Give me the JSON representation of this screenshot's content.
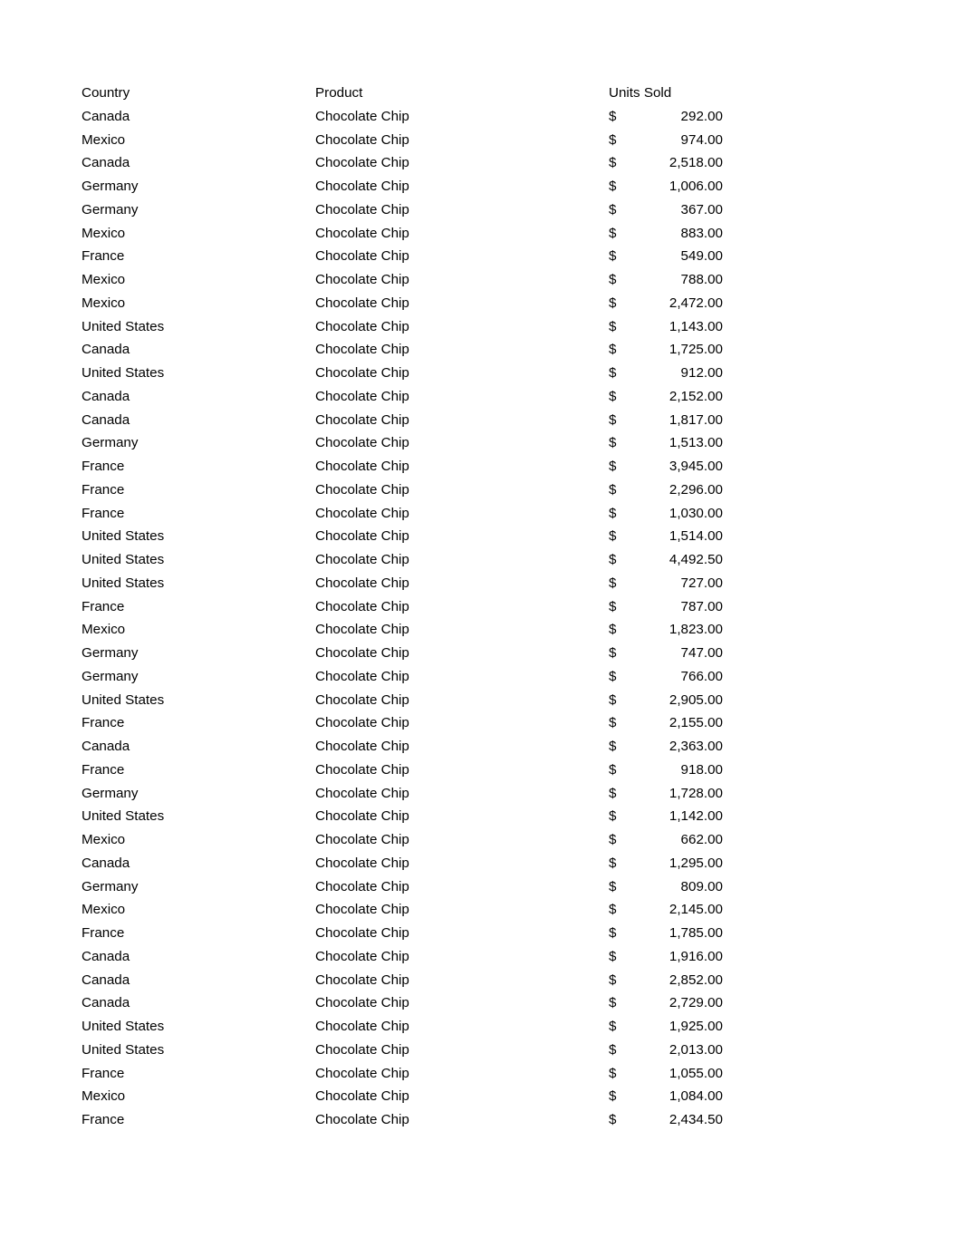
{
  "document": {
    "kind": "spreadsheet-table",
    "page_background": "#ffffff",
    "text_color": "#000000"
  },
  "table": {
    "headers": {
      "country": "Country",
      "product": "Product",
      "units_sold": "Units Sold"
    },
    "currency_symbol": "$",
    "rows": [
      {
        "country": "Canada",
        "product": "Chocolate Chip",
        "amount": "292.00"
      },
      {
        "country": "Mexico",
        "product": "Chocolate Chip",
        "amount": "974.00"
      },
      {
        "country": "Canada",
        "product": "Chocolate Chip",
        "amount": "2,518.00"
      },
      {
        "country": "Germany",
        "product": "Chocolate Chip",
        "amount": "1,006.00"
      },
      {
        "country": "Germany",
        "product": "Chocolate Chip",
        "amount": "367.00"
      },
      {
        "country": "Mexico",
        "product": "Chocolate Chip",
        "amount": "883.00"
      },
      {
        "country": "France",
        "product": "Chocolate Chip",
        "amount": "549.00"
      },
      {
        "country": "Mexico",
        "product": "Chocolate Chip",
        "amount": "788.00"
      },
      {
        "country": "Mexico",
        "product": "Chocolate Chip",
        "amount": "2,472.00"
      },
      {
        "country": "United States",
        "product": "Chocolate Chip",
        "amount": "1,143.00"
      },
      {
        "country": "Canada",
        "product": "Chocolate Chip",
        "amount": "1,725.00"
      },
      {
        "country": "United States",
        "product": "Chocolate Chip",
        "amount": "912.00"
      },
      {
        "country": "Canada",
        "product": "Chocolate Chip",
        "amount": "2,152.00"
      },
      {
        "country": "Canada",
        "product": "Chocolate Chip",
        "amount": "1,817.00"
      },
      {
        "country": "Germany",
        "product": "Chocolate Chip",
        "amount": "1,513.00"
      },
      {
        "country": "France",
        "product": "Chocolate Chip",
        "amount": "3,945.00"
      },
      {
        "country": "France",
        "product": "Chocolate Chip",
        "amount": "2,296.00"
      },
      {
        "country": "France",
        "product": "Chocolate Chip",
        "amount": "1,030.00"
      },
      {
        "country": "United States",
        "product": "Chocolate Chip",
        "amount": "1,514.00"
      },
      {
        "country": "United States",
        "product": "Chocolate Chip",
        "amount": "4,492.50"
      },
      {
        "country": "United States",
        "product": "Chocolate Chip",
        "amount": "727.00"
      },
      {
        "country": "France",
        "product": "Chocolate Chip",
        "amount": "787.00"
      },
      {
        "country": "Mexico",
        "product": "Chocolate Chip",
        "amount": "1,823.00"
      },
      {
        "country": "Germany",
        "product": "Chocolate Chip",
        "amount": "747.00"
      },
      {
        "country": "Germany",
        "product": "Chocolate Chip",
        "amount": "766.00"
      },
      {
        "country": "United States",
        "product": "Chocolate Chip",
        "amount": "2,905.00"
      },
      {
        "country": "France",
        "product": "Chocolate Chip",
        "amount": "2,155.00"
      },
      {
        "country": "Canada",
        "product": "Chocolate Chip",
        "amount": "2,363.00"
      },
      {
        "country": "France",
        "product": "Chocolate Chip",
        "amount": "918.00"
      },
      {
        "country": "Germany",
        "product": "Chocolate Chip",
        "amount": "1,728.00"
      },
      {
        "country": "United States",
        "product": "Chocolate Chip",
        "amount": "1,142.00"
      },
      {
        "country": "Mexico",
        "product": "Chocolate Chip",
        "amount": "662.00"
      },
      {
        "country": "Canada",
        "product": "Chocolate Chip",
        "amount": "1,295.00"
      },
      {
        "country": "Germany",
        "product": "Chocolate Chip",
        "amount": "809.00"
      },
      {
        "country": "Mexico",
        "product": "Chocolate Chip",
        "amount": "2,145.00"
      },
      {
        "country": "France",
        "product": "Chocolate Chip",
        "amount": "1,785.00"
      },
      {
        "country": "Canada",
        "product": "Chocolate Chip",
        "amount": "1,916.00"
      },
      {
        "country": "Canada",
        "product": "Chocolate Chip",
        "amount": "2,852.00"
      },
      {
        "country": "Canada",
        "product": "Chocolate Chip",
        "amount": "2,729.00"
      },
      {
        "country": "United States",
        "product": "Chocolate Chip",
        "amount": "1,925.00"
      },
      {
        "country": "United States",
        "product": "Chocolate Chip",
        "amount": "2,013.00"
      },
      {
        "country": "France",
        "product": "Chocolate Chip",
        "amount": "1,055.00"
      },
      {
        "country": "Mexico",
        "product": "Chocolate Chip",
        "amount": "1,084.00"
      },
      {
        "country": "France",
        "product": "Chocolate Chip",
        "amount": "2,434.50"
      }
    ]
  }
}
